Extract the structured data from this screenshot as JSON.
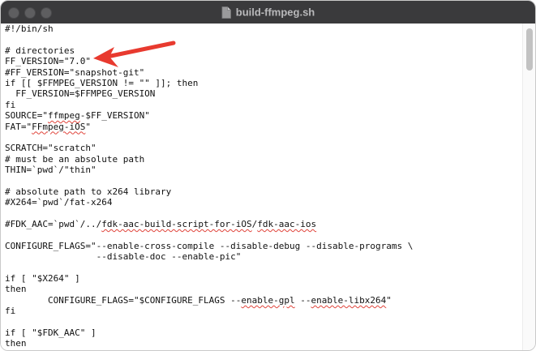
{
  "window": {
    "title": "build-ffmpeg.sh",
    "title_icon": "document-icon"
  },
  "traffic_lights": [
    "close",
    "minimize",
    "zoom"
  ],
  "annotation": {
    "type": "arrow",
    "color": "#e83a2f",
    "points_to": "FF_VERSION line"
  },
  "code_lines": [
    [
      {
        "t": "#!/bin/sh"
      }
    ],
    [
      {
        "t": ""
      }
    ],
    [
      {
        "t": "# directories"
      }
    ],
    [
      {
        "t": "FF_VERSION=\"7.0\""
      }
    ],
    [
      {
        "t": "#FF_VERSION=\"snapshot-git\""
      }
    ],
    [
      {
        "t": "if [[ $FFMPEG_VERSION != \"\" ]]; then"
      }
    ],
    [
      {
        "t": "  FF_VERSION=$FFMPEG_VERSION"
      }
    ],
    [
      {
        "t": "fi"
      }
    ],
    [
      {
        "t": "SOURCE=\""
      },
      {
        "t": "ffmpeg",
        "s": true
      },
      {
        "t": "-$FF_VERSION\""
      }
    ],
    [
      {
        "t": "FAT=\""
      },
      {
        "t": "FFmpeg-iOS",
        "s": true
      },
      {
        "t": "\""
      }
    ],
    [
      {
        "t": ""
      }
    ],
    [
      {
        "t": "SCRATCH=\"scratch\""
      }
    ],
    [
      {
        "t": "# must be an absolute path"
      }
    ],
    [
      {
        "t": "THIN=`pwd`/\"thin\""
      }
    ],
    [
      {
        "t": ""
      }
    ],
    [
      {
        "t": "# absolute path to x264 library"
      }
    ],
    [
      {
        "t": "#X264=`pwd`/fat-x264"
      }
    ],
    [
      {
        "t": ""
      }
    ],
    [
      {
        "t": "#FDK_AAC=`pwd`/../"
      },
      {
        "t": "fdk-aac-build-script-for-iOS",
        "s": true
      },
      {
        "t": "/"
      },
      {
        "t": "fdk-aac-ios",
        "s": true
      }
    ],
    [
      {
        "t": ""
      }
    ],
    [
      {
        "t": "CONFIGURE_FLAGS=\"--enable-cross-compile --disable-debug --disable-programs \\"
      }
    ],
    [
      {
        "t": "                 --disable-doc --enable-pic\""
      }
    ],
    [
      {
        "t": ""
      }
    ],
    [
      {
        "t": "if [ \"$X264\" ]"
      }
    ],
    [
      {
        "t": "then"
      }
    ],
    [
      {
        "t": "        CONFIGURE_FLAGS=\"$CONFIGURE_FLAGS --"
      },
      {
        "t": "enable-gpl",
        "s": true
      },
      {
        "t": " --"
      },
      {
        "t": "enable-libx264",
        "s": true
      },
      {
        "t": "\""
      }
    ],
    [
      {
        "t": "fi"
      }
    ],
    [
      {
        "t": ""
      }
    ],
    [
      {
        "t": "if [ \"$FDK_AAC\" ]"
      }
    ],
    [
      {
        "t": "then"
      }
    ]
  ]
}
